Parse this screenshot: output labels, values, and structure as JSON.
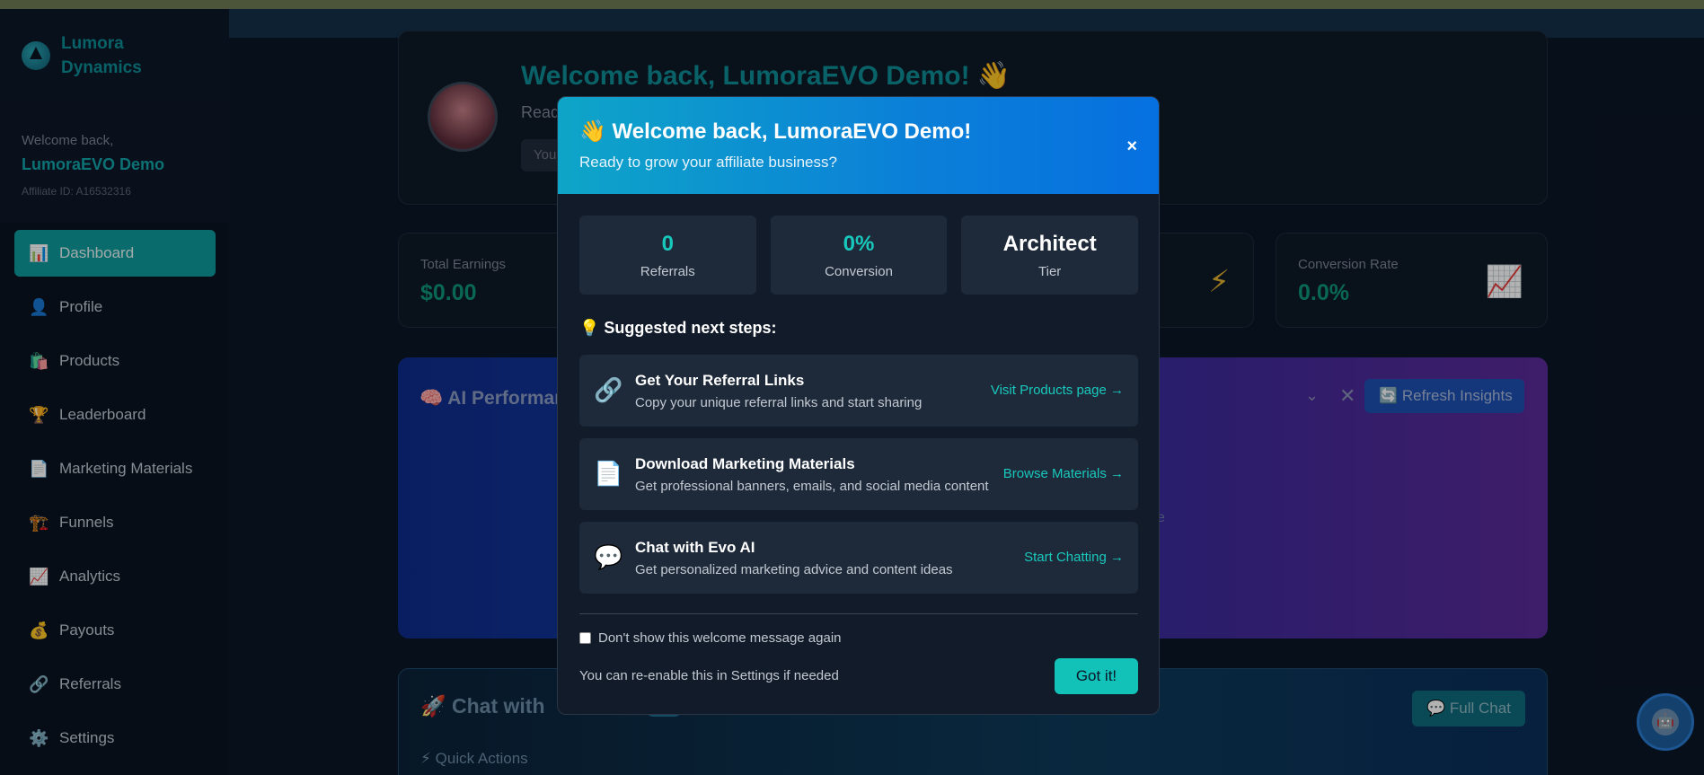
{
  "sidebar": {
    "brand": {
      "name": "Lumora Dynamics"
    },
    "user": {
      "welcome": "Welcome back,",
      "name": "LumoraEVO Demo",
      "affiliate_id": "Affiliate ID: A16532316"
    },
    "items": [
      {
        "icon": "📊",
        "label": "Dashboard",
        "active": true
      },
      {
        "icon": "👤",
        "label": "Profile"
      },
      {
        "icon": "🛍️",
        "label": "Products"
      },
      {
        "icon": "🏆",
        "label": "Leaderboard"
      },
      {
        "icon": "📄",
        "label": "Marketing Materials"
      },
      {
        "icon": "🏗️",
        "label": "Funnels"
      },
      {
        "icon": "📈",
        "label": "Analytics"
      },
      {
        "icon": "💰",
        "label": "Payouts"
      },
      {
        "icon": "🔗",
        "label": "Referrals"
      },
      {
        "icon": "⚙️",
        "label": "Settings"
      }
    ]
  },
  "hero": {
    "title": "Welcome back, LumoraEVO Demo! 👋",
    "subtitle": "Read",
    "button": "You"
  },
  "stats": [
    {
      "label": "Total Earnings",
      "value": "$0.00"
    },
    {
      "icon": "⚡"
    },
    {
      "label": "Conversion Rate",
      "value": "0.0%",
      "icon": "📈"
    }
  ],
  "ai_panel": {
    "title": "🧠 AI Performan",
    "chevron": "⌄",
    "close": "✕",
    "refresh": "🔄 Refresh Insights",
    "faint": "e"
  },
  "chat_panel": {
    "title": "🚀 Chat with",
    "full_chat": "💬 Full Chat",
    "quick_actions": "⚡ Quick Actions"
  },
  "modal": {
    "title": "👋 Welcome back, LumoraEVO Demo!",
    "subtitle": "Ready to grow your affiliate business?",
    "close": "×",
    "stats": [
      {
        "value": "0",
        "label": "Referrals"
      },
      {
        "value": "0%",
        "label": "Conversion"
      },
      {
        "value": "Architect",
        "label": "Tier"
      }
    ],
    "steps_title": "💡 Suggested next steps:",
    "steps": [
      {
        "icon": "🔗",
        "title": "Get Your Referral Links",
        "desc": "Copy your unique referral links and start sharing",
        "action": "Visit Products page →"
      },
      {
        "icon": "📄",
        "title": "Download Marketing Materials",
        "desc": "Get professional banners, emails, and social media content",
        "action": "Browse Materials →"
      },
      {
        "icon": "💬",
        "title": "Chat with Evo AI",
        "desc": "Get personalized marketing advice and content ideas",
        "action": "Start Chatting →"
      }
    ],
    "dont_show": "Don't show this welcome message again",
    "reenable": "You can re-enable this in Settings if needed",
    "got_it": "Got it!"
  },
  "chat_bot": {
    "icon": "🤖"
  }
}
